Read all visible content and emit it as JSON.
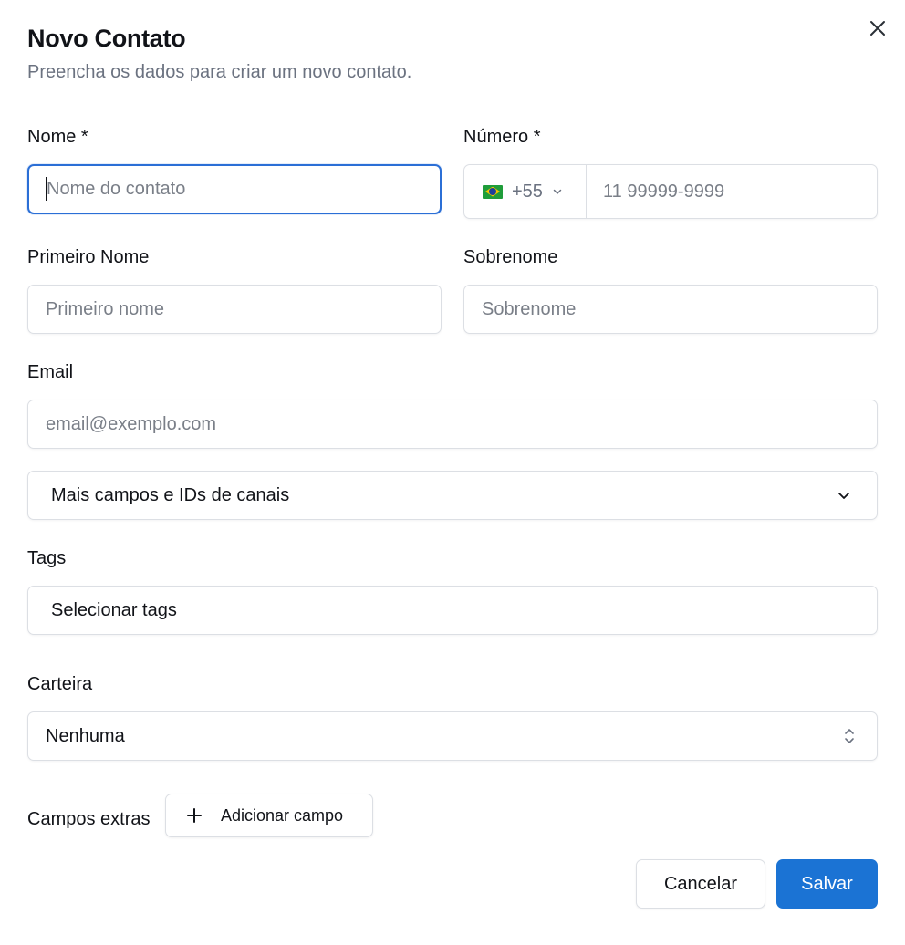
{
  "dialog": {
    "title": "Novo Contato",
    "subtitle": "Preencha os dados para criar um novo contato.",
    "close_icon": "close-icon"
  },
  "fields": {
    "nome": {
      "label": "Nome *",
      "placeholder": "Nome do contato",
      "value": ""
    },
    "numero": {
      "label": "Número *",
      "country_flag": "brazil-flag-icon",
      "country_code": "+55",
      "placeholder": "11 99999-9999",
      "value": ""
    },
    "primeiro_nome": {
      "label": "Primeiro Nome",
      "placeholder": "Primeiro nome",
      "value": ""
    },
    "sobrenome": {
      "label": "Sobrenome",
      "placeholder": "Sobrenome",
      "value": ""
    },
    "email": {
      "label": "Email",
      "placeholder": "email@exemplo.com",
      "value": ""
    },
    "mais_campos": {
      "label": "Mais campos e IDs de canais",
      "icon": "chevron-down-icon"
    },
    "tags": {
      "label": "Tags",
      "button_text": "Selecionar tags"
    },
    "carteira": {
      "label": "Carteira",
      "selected": "Nenhuma",
      "icon": "chevron-up-down-icon"
    },
    "campos_extras": {
      "label": "Campos extras",
      "add_button": "Adicionar campo",
      "add_icon": "plus-icon"
    }
  },
  "footer": {
    "cancel_label": "Cancelar",
    "save_label": "Salvar"
  },
  "colors": {
    "primary": "#1b73d4",
    "focus_border": "#2b6fd6",
    "border": "#dcdfe4",
    "muted_text": "#6b7280"
  }
}
